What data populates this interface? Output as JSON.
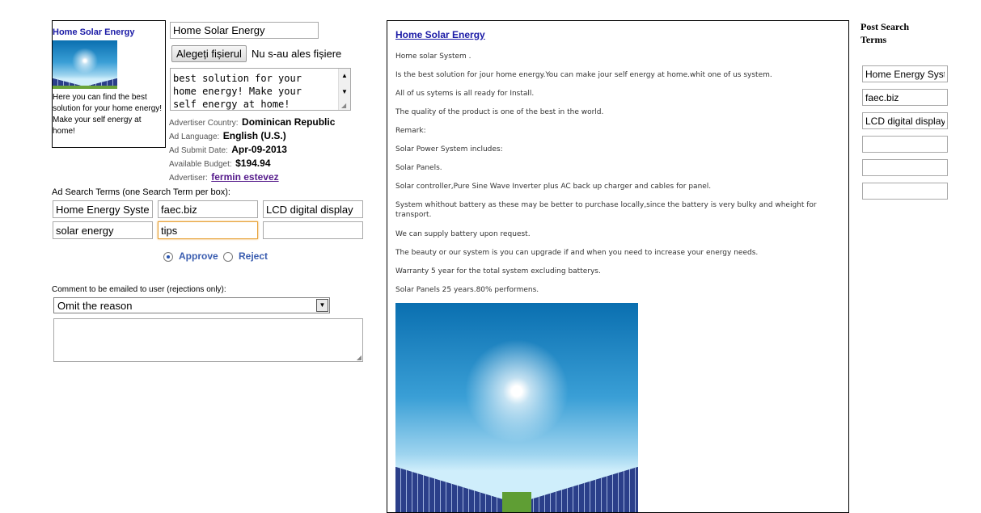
{
  "ad_box": {
    "title": "Home Solar Energy",
    "text": "Here you can find the best solution for your home energy! Make your self energy at home!"
  },
  "title_input": {
    "value": "Home Solar Energy"
  },
  "file_button": {
    "label": "Alegeți fișierul",
    "status": "Nu s-au ales fișiere"
  },
  "desc_textarea": {
    "value": "best solution for your home energy! Make your self energy at home!"
  },
  "advertiser_info": {
    "country_label": "Advertiser Country:",
    "country": "Dominican Republic",
    "language_label": "Ad Language:",
    "language": "English (U.S.)",
    "submit_label": "Ad Submit Date:",
    "submit_date": "Apr-09-2013",
    "budget_label": "Available Budget:",
    "budget": "$194.94",
    "advertiser_label": "Advertiser:",
    "advertiser": "fermin estevez"
  },
  "search_terms": {
    "label": "Ad Search Terms (one Search Term per box):",
    "terms": [
      "Home Energy System",
      "faec.biz",
      "LCD digital display",
      "solar energy",
      "tips",
      ""
    ]
  },
  "decision": {
    "approve": "Approve",
    "reject": "Reject",
    "selected": "approve"
  },
  "comment": {
    "label": "Comment to be emailed to user (rejections only):",
    "select_value": "Omit the reason",
    "textarea": ""
  },
  "preview": {
    "title": "Home Solar Energy",
    "paragraphs": [
      "Home solar System .",
      "Is the best solution for jour home energy.You can make jour self energy at home.whit one of us system.",
      "All of us sytems is  all ready for Install.",
      "The quality  of the product is one of the best in the world.",
      "Remark:",
      "Solar Power System includes:",
      "Solar Panels.",
      "Solar controller,Pure Sine Wave Inverter plus AC back up charger and cables for panel.",
      "System whithout battery as these may be better to purchase locally,since the battery is very bulky and wheight for transport.",
      "We can supply battery upon request.",
      "The beauty or our system is you can upgrade if and  when you need to increase your energy needs.",
      "Warranty 5 year for the total system excluding batterys.",
      "Solar Panels 25 years.80% performens."
    ]
  },
  "post_search": {
    "title": "Post Search Terms",
    "terms": [
      "Home Energy System",
      "faec.biz",
      "LCD digital display",
      "",
      "",
      ""
    ]
  }
}
